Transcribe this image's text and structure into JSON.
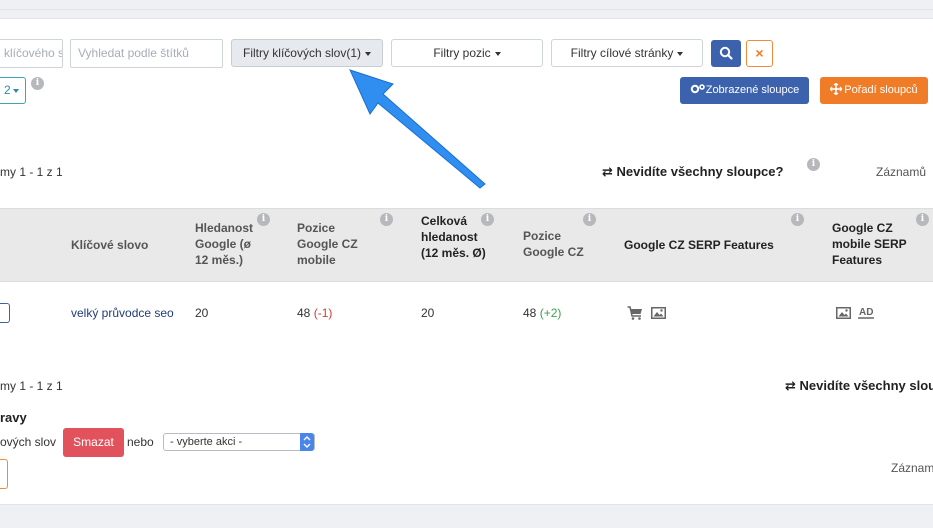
{
  "filters": {
    "tag_search_placeholder_partial": "klíčového s",
    "tag_search_placeholder": "Vyhledat podle štítků",
    "keyword_filters_label": "Filtry klíčových slov(1)",
    "position_filters_label": "Filtry pozic",
    "landing_page_filters_label": "Filtry cílové stránky",
    "search_icon": "search-icon",
    "clear_icon": "×"
  },
  "pagination": {
    "page_size_label": "2",
    "records_top": "my 1 - 1 z 1",
    "records_bottom": "my 1 - 1 z 1"
  },
  "toolbar": {
    "shown_columns_label": "Zobrazené sloupce",
    "column_order_label": "Pořadí sloupců",
    "missing_columns_label": "Nevidíte všechny sloupce?",
    "records_label": "Záznamů",
    "records_label_bottom": "Záznam"
  },
  "table": {
    "headers": {
      "keyword": "Klíčové slovo",
      "search_volume": "Hledanost Google (ø 12 měs.)",
      "position_mobile": "Pozice Google CZ mobile",
      "total_volume": "Celková hledanost (12 měs. Ø)",
      "position": "Pozice Google CZ",
      "serp_features": "Google CZ SERP Features",
      "serp_features_mobile": "Google CZ mobile SERP Features"
    },
    "rows": [
      {
        "keyword": "velký průvodce seo",
        "search_volume": "20",
        "position_mobile": "48",
        "position_mobile_change": "(-1)",
        "total_volume": "20",
        "position": "48",
        "position_change": "(+2)",
        "serp_features": [
          "cart-icon",
          "image-icon"
        ],
        "serp_features_mobile": [
          "image-icon",
          "ad-icon"
        ]
      }
    ]
  },
  "bulk": {
    "heading_partial": "ravy",
    "label_partial": "ových slov",
    "delete_label": "Smazat",
    "or_label": "nebo",
    "action_select": "- vyberte akci -"
  },
  "colors": {
    "primary": "#3d62ad",
    "accent": "#f07c28",
    "danger": "#e2525d",
    "annotation_arrow": "#2f8ef0"
  }
}
